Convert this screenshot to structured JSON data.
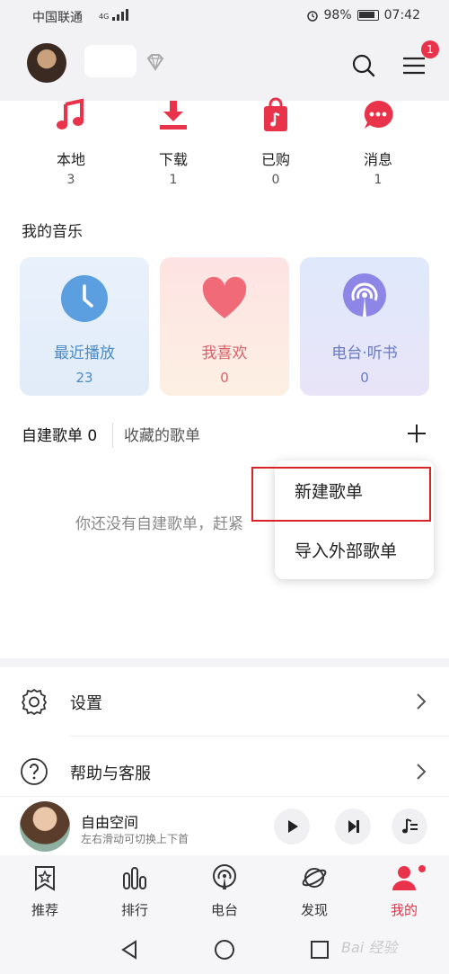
{
  "status_bar": {
    "carrier": "中国联通",
    "network": "4G",
    "battery": "98%",
    "time": "07:42"
  },
  "header": {
    "menu_badge": "1"
  },
  "quick_access": [
    {
      "label": "本地",
      "count": "3",
      "icon": "music-note-icon"
    },
    {
      "label": "下载",
      "count": "1",
      "icon": "download-icon"
    },
    {
      "label": "已购",
      "count": "0",
      "icon": "purchased-bag-icon"
    },
    {
      "label": "消息",
      "count": "1",
      "icon": "message-bubble-icon"
    }
  ],
  "my_music": {
    "title": "我的音乐",
    "tiles": [
      {
        "label": "最近播放",
        "count": "23",
        "icon": "clock-icon"
      },
      {
        "label": "我喜欢",
        "count": "0",
        "icon": "heart-icon"
      },
      {
        "label": "电台·听书",
        "count": "0",
        "icon": "radio-icon"
      }
    ]
  },
  "playlist_tabs": {
    "mine": "自建歌单 0",
    "favorites": "收藏的歌单"
  },
  "empty_state": "你还没有自建歌单，赶紧",
  "popup_menu": {
    "items": [
      "新建歌单",
      "导入外部歌单"
    ]
  },
  "settings_rows": [
    {
      "label": "设置",
      "icon": "gear-icon"
    },
    {
      "label": "帮助与客服",
      "icon": "help-icon"
    }
  ],
  "player": {
    "title": "自由空间",
    "subtitle": "左右滑动可切换上下首"
  },
  "bottom_nav": [
    {
      "label": "推荐",
      "icon": "star-bookmark-icon"
    },
    {
      "label": "排行",
      "icon": "ranking-bars-icon"
    },
    {
      "label": "电台",
      "icon": "radio-icon"
    },
    {
      "label": "发现",
      "icon": "planet-icon"
    },
    {
      "label": "我的",
      "icon": "person-icon",
      "active": true
    }
  ],
  "colors": {
    "accent": "#e8334a",
    "highlight_box": "#d9252a",
    "recent_tile": "#e6f0fb",
    "liked_tile": "#fde6e4",
    "radio_tile": "#e4ecfb"
  },
  "watermark": "Bai 经验"
}
